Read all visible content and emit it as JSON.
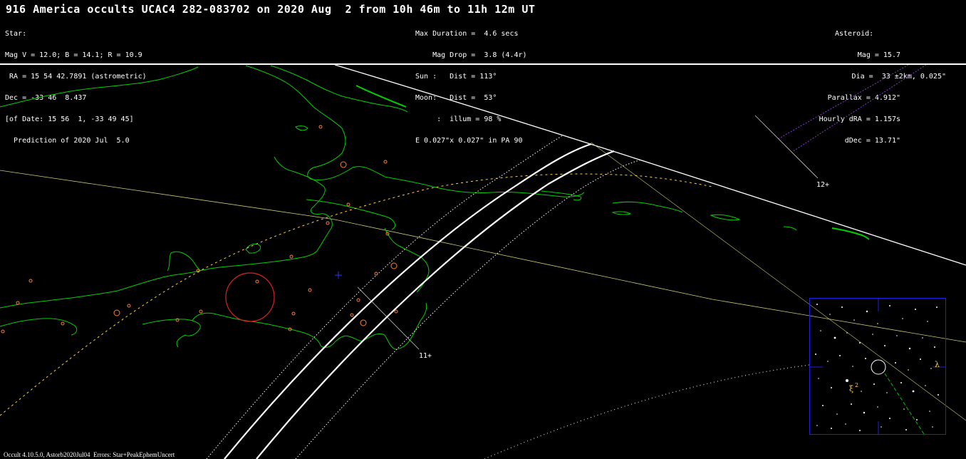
{
  "title": "916 America occults UCAC4 282-083702 on 2020 Aug  2 from 10h 46m to 11h 12m UT",
  "star_info": [
    "Star:",
    "Mag V = 12.0; B = 14.1; R = 10.9",
    " RA = 15 54 42.7891 (astrometric)",
    "Dec = -33 46  8.437",
    "[of Date: 15 56  1, -33 49 45]",
    "  Prediction of 2020 Jul  5.0"
  ],
  "event_info": [
    "Max Duration =  4.6 secs",
    "    Mag Drop =  3.8 (4.4r)",
    "Sun :   Dist = 113°",
    "Moon:   Dist =  53°",
    "     :  illum = 98 %",
    "E 0.027\"x 0.027\" in PA 90"
  ],
  "asteroid_info": [
    "Asteroid:",
    "Mag = 15.7",
    "Dia =  33 ±2km, 0.025\"",
    "Parallax = 4.912\"",
    "Hourly dRA = 1.157s",
    "dDec = 13.71\""
  ],
  "time_markers": {
    "t12": "12+",
    "t11": "11+"
  },
  "inset_labels": {
    "lambda": "λ",
    "xi": "ξ",
    "two": "2"
  },
  "footer": "Occult 4.10.5.0, Astorb2020Jul04  Errors: Star+PeakEphemUncert",
  "colors": {
    "coast": "#00d000",
    "path": "#ffffff",
    "sites": "#ff9040",
    "sun_line": "#e0e080",
    "circle": "#e02020",
    "inset_border": "#2020e0",
    "cross": "#3030ff"
  },
  "icons": {
    "moon_circle": "red-circle-icon",
    "center_marker": "blue-cross-icon"
  }
}
